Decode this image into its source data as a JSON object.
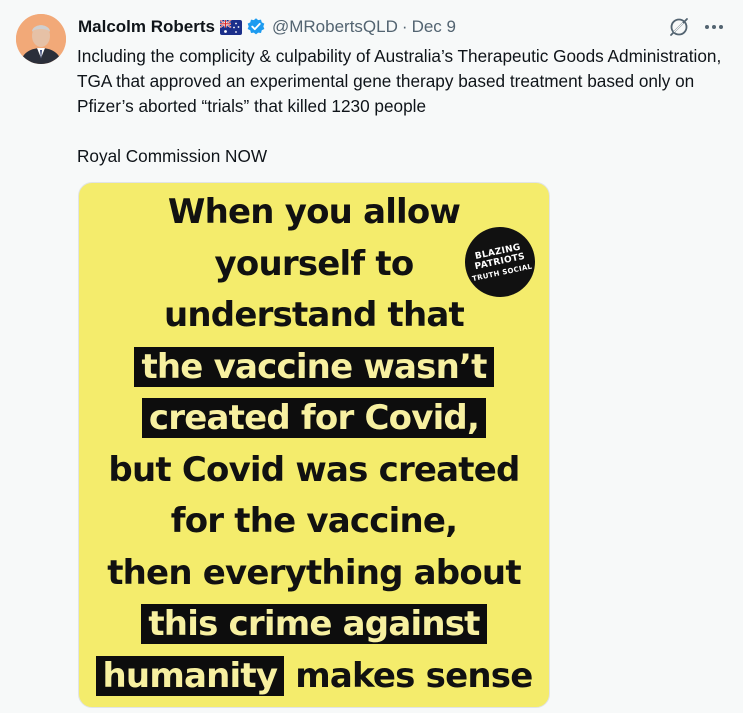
{
  "tweet": {
    "author_name": "Malcolm Roberts",
    "handle": "@MRobertsQLD",
    "separator": "·",
    "date": "Dec 9",
    "text": "Including the complicity & culpability of Australia’s Therapeutic Goods Administration, TGA that approved an experimental gene therapy based treatment based only on Pfizer’s aborted “trials” that killed 1230 people\n\nRoyal Commission NOW",
    "icons": [
      "avatar",
      "australia-flag-icon",
      "verified-badge-icon",
      "grok-icon",
      "more-icon"
    ]
  },
  "meme": {
    "lines": [
      "When you allow",
      "yourself to",
      "understand that",
      "the vaccine wasn’t",
      "created for Covid,",
      "but Covid was created",
      "for the vaccine,",
      "then everything about",
      "this crime against",
      "humanity",
      "makes sense"
    ],
    "badge_line1": "BLAZING PATRIOTS",
    "badge_line2": "TRUTH SOCIAL",
    "background_color": "#f4ec6c",
    "highlight_color": "#0d0d0d"
  }
}
